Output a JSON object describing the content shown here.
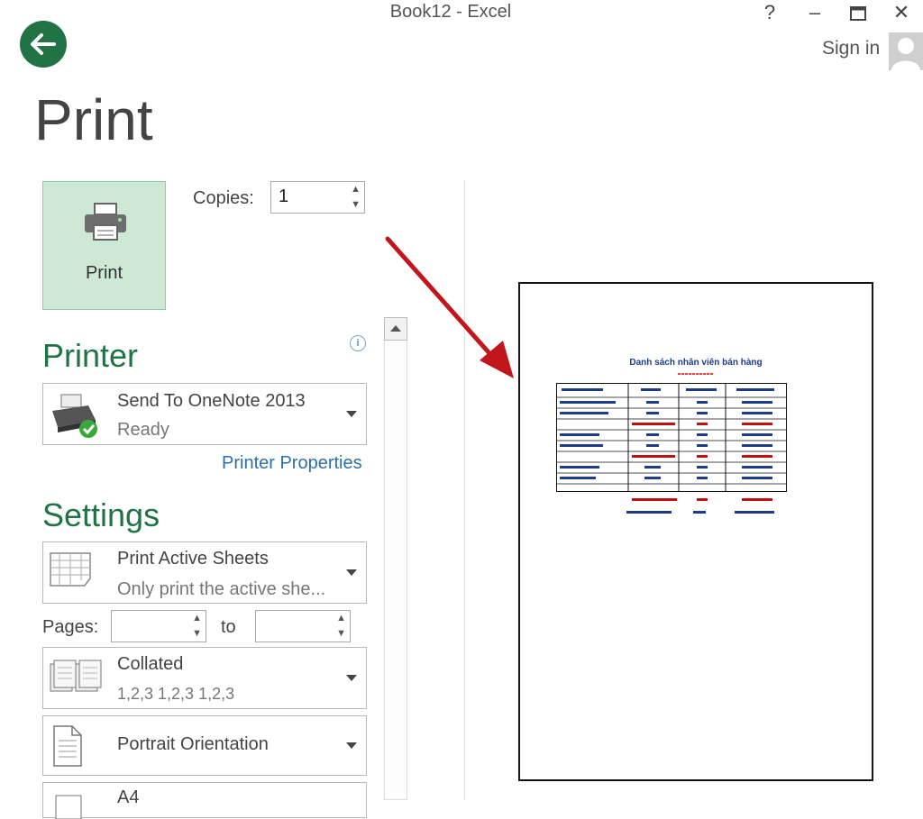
{
  "window": {
    "title": "Book12 - Excel",
    "help_label": "?",
    "minimize_label": "–",
    "maximize_label": "🗖",
    "close_label": "✕"
  },
  "account": {
    "sign_in_label": "Sign in"
  },
  "backstage": {
    "page_title": "Print"
  },
  "print_panel": {
    "print_button_label": "Print",
    "copies_label": "Copies:",
    "copies_value": "1"
  },
  "printer": {
    "heading": "Printer",
    "name": "Send To OneNote 2013",
    "status": "Ready",
    "properties_link": "Printer Properties",
    "info_icon_label": "i"
  },
  "settings": {
    "heading": "Settings",
    "scope_title": "Print Active Sheets",
    "scope_desc": "Only print the active she...",
    "pages_label": "Pages:",
    "to_label": "to",
    "collation_title": "Collated",
    "collation_desc": "1,2,3    1,2,3    1,2,3",
    "orientation_title": "Portrait Orientation",
    "paper_title": "A4"
  },
  "preview": {
    "title": "Danh sách nhân viên bán hàng",
    "accent_color": "#1e3c8c",
    "highlight_color": "#c01010"
  },
  "colors": {
    "brand_green": "#217346",
    "print_button_bg": "#cde9d6",
    "annotation_arrow": "#c0161c"
  }
}
